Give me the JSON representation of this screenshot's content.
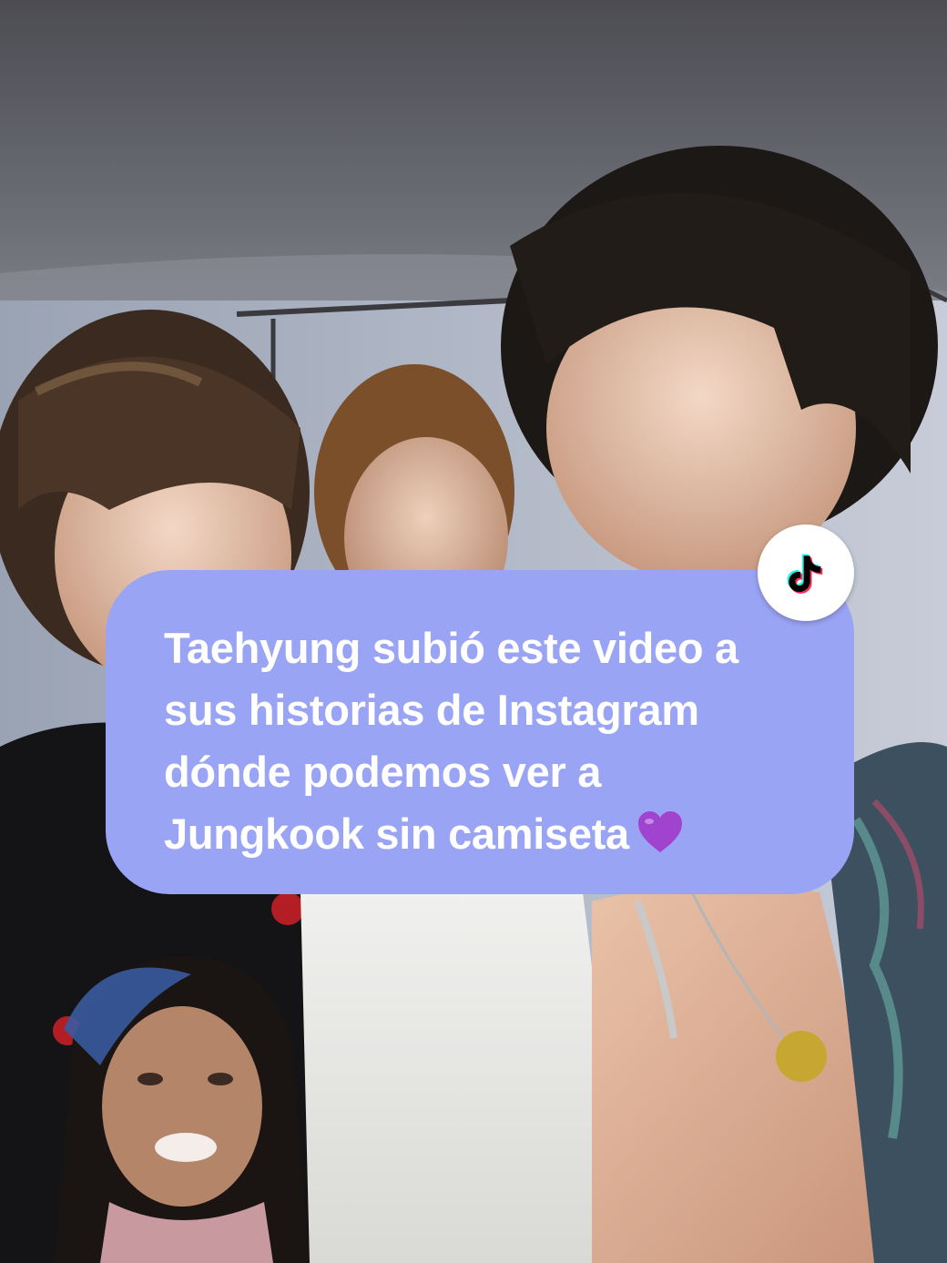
{
  "video": {
    "scene": "backstage selfie video frame",
    "pip_overlay": "reaction-camera"
  },
  "badge": {
    "icon": "tiktok-logo-icon",
    "colors": {
      "cyan": "#25f4ee",
      "red": "#fe2c55",
      "black": "#000000"
    }
  },
  "caption": {
    "lines": [
      "Taehyung subió este video a",
      "sus historias de Instagram",
      "dónde podemos ver a",
      "Jungkook sin camiseta"
    ],
    "emoji": "purple-heart-icon",
    "bubble_color": "#9aa4f4",
    "text_color": "#ffffff"
  }
}
